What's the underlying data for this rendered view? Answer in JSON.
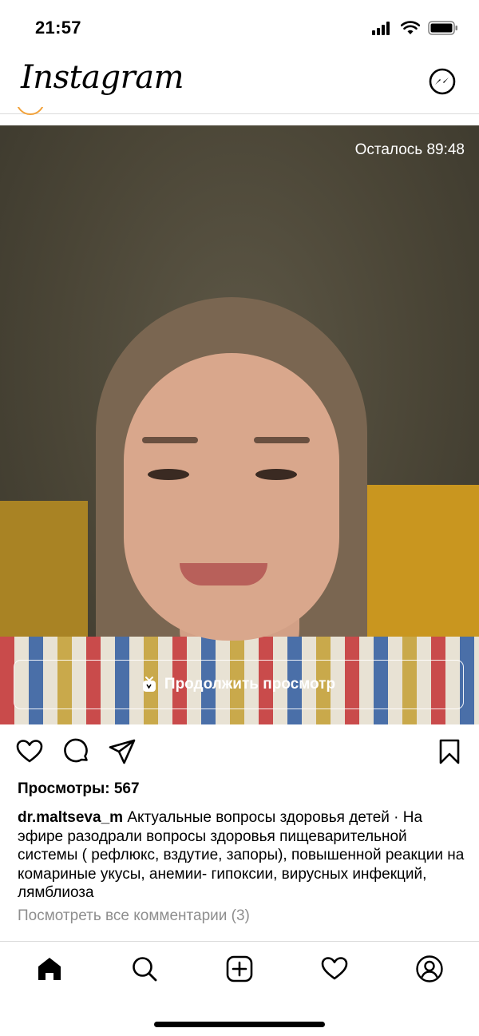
{
  "status_bar": {
    "time": "21:57",
    "icons": [
      "signal-icon",
      "wifi-icon",
      "battery-icon"
    ]
  },
  "header": {
    "logo": "Instagram",
    "messenger_icon": "messenger-icon"
  },
  "post": {
    "time_left": "Осталось 89:48",
    "continue_label": "Продолжить просмотр",
    "views": "Просмотры: 567",
    "username": "dr.maltseva_m",
    "caption": "Актуальные вопросы здоровья детей · На эфире разодрали вопросы здоровья пищеварительной системы ( рефлюкс, вздутие, запоры), повышенной реакции на комариные укусы, анемии- гипоксии, вирусных инфекций, лямблиоза",
    "comments_link": "Посмотреть все комментарии (3)"
  },
  "actions": [
    "heart-icon",
    "comment-icon",
    "share-icon",
    "bookmark-icon"
  ],
  "bottom_nav": [
    "home-icon",
    "search-icon",
    "add-icon",
    "activity-icon",
    "profile-icon"
  ],
  "colors": {
    "accent_ring": "#f2a23a",
    "divider": "#dbdbdb",
    "muted": "#8e8e8e"
  }
}
